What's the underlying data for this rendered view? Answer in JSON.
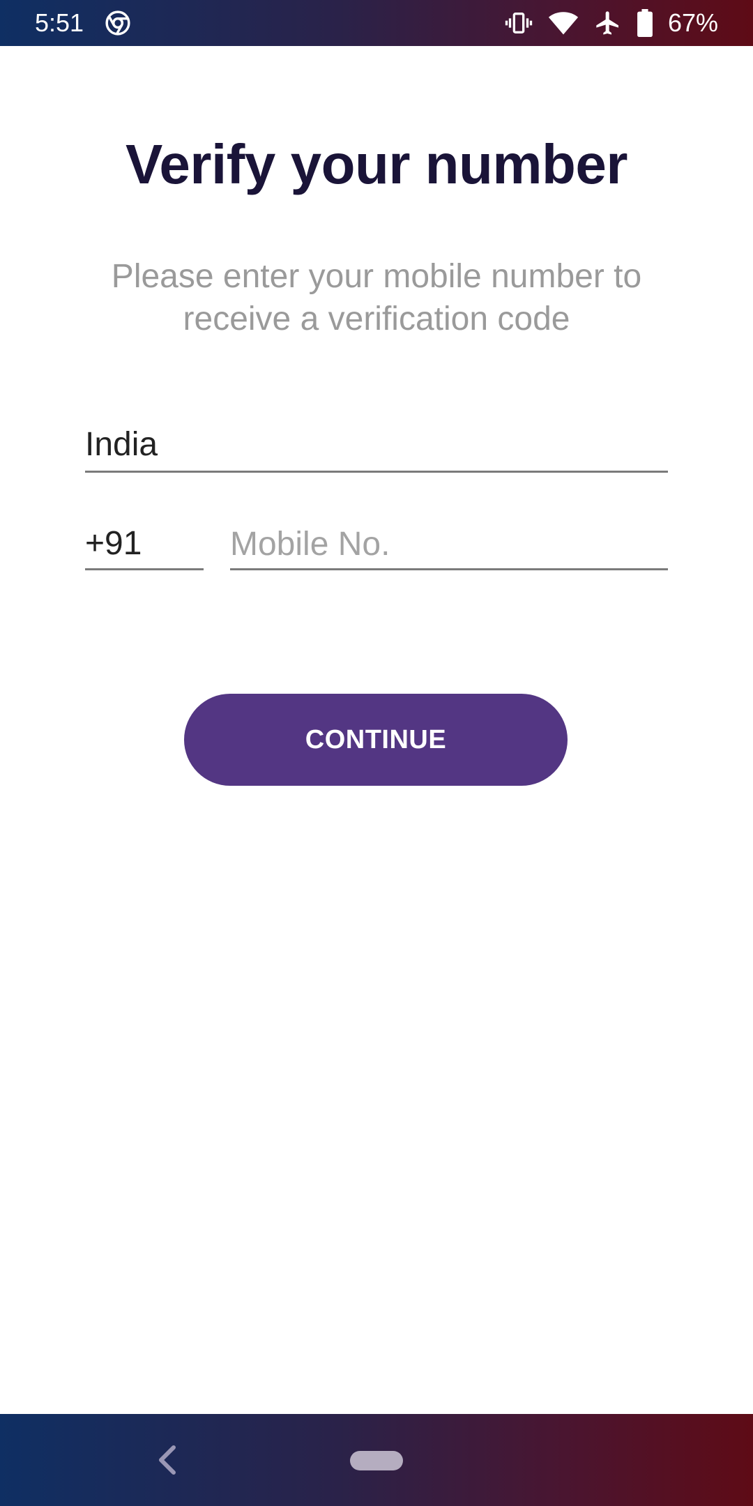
{
  "status_bar": {
    "time": "5:51",
    "battery_percent": "67%",
    "icons": [
      "chrome-icon",
      "vibrate-icon",
      "wifi-icon",
      "airplane-icon",
      "battery-icon"
    ]
  },
  "screen": {
    "title": "Verify your number",
    "subtitle": "Please enter your mobile number to receive a verification code",
    "country": "India",
    "country_code": "+91",
    "mobile_placeholder": "Mobile No.",
    "mobile_value": "",
    "continue_label": "CONTINUE"
  },
  "nav_bar": {
    "icons": [
      "back-icon",
      "home-pill"
    ]
  },
  "colors": {
    "accent": "#533683",
    "title": "#1a1438",
    "subtitle": "#9a9a9a"
  }
}
